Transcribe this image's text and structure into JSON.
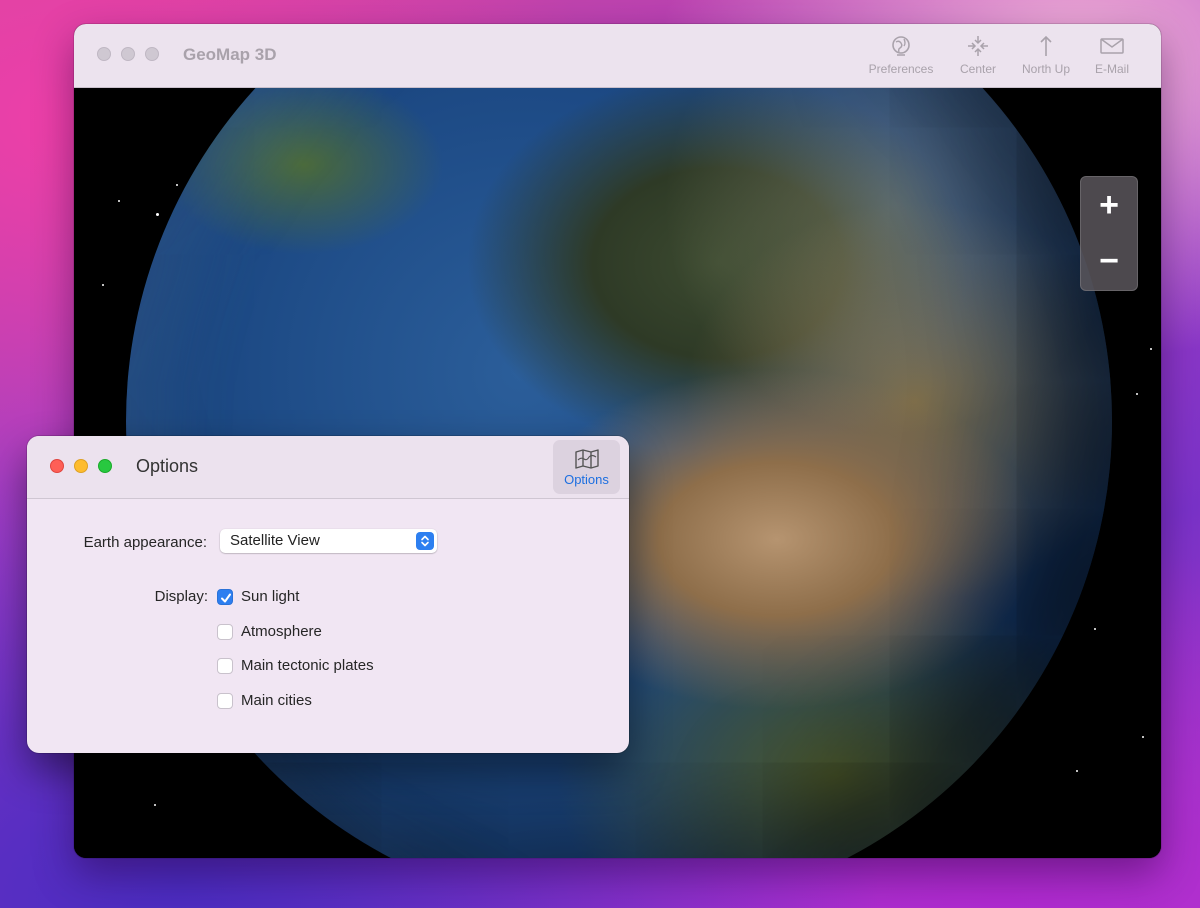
{
  "main_window": {
    "title": "GeoMap 3D",
    "toolbar": [
      {
        "label": "Preferences",
        "icon": "globe-icon"
      },
      {
        "label": "Center",
        "icon": "center-arrows-icon"
      },
      {
        "label": "North Up",
        "icon": "arrow-up-icon"
      },
      {
        "label": "E-Mail",
        "icon": "envelope-icon"
      }
    ],
    "zoom": {
      "in": "+",
      "out": "−"
    }
  },
  "options_window": {
    "title": "Options",
    "tab_label": "Options",
    "appearance_label": "Earth appearance:",
    "appearance_value": "Satellite View",
    "display_label": "Display:",
    "display_options": [
      {
        "label": "Sun light",
        "checked": true
      },
      {
        "label": "Atmosphere",
        "checked": false
      },
      {
        "label": "Main tectonic plates",
        "checked": false
      },
      {
        "label": "Main cities",
        "checked": false
      }
    ]
  },
  "colors": {
    "accent": "#2d7ff0",
    "close": "#fe5f57",
    "minimize": "#febc2e",
    "zoom": "#28c840"
  }
}
